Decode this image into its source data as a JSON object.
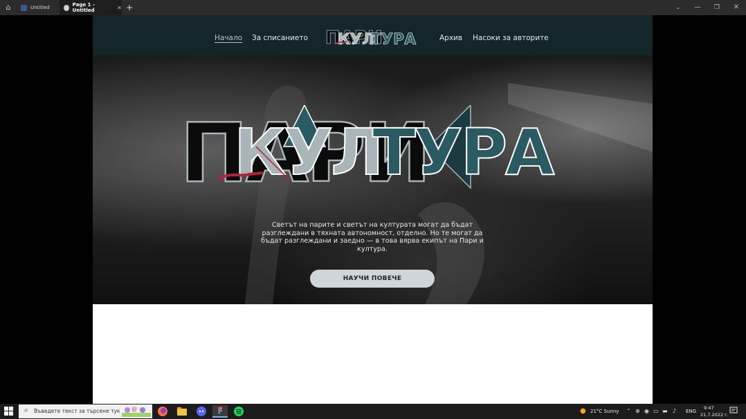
{
  "titlebar": {
    "tabs": [
      {
        "label": "Untitled"
      },
      {
        "label": "Page 1 - Untitled"
      }
    ]
  },
  "site": {
    "nav": {
      "home": "Начало",
      "about": "За списанието",
      "archive": "Архив",
      "authors": "Насоки за авторите"
    },
    "logo_text": "Пари и Култура",
    "hero": {
      "description": "Светът на парите и светът на културата могат да бъдат разглеждани в тяхната автономност, отделно. Но те могат да бъдат разглеждани и заедно — в това вярва екипът на Пари и култура.",
      "cta_label": "НАУЧИ ПОВЕЧЕ"
    },
    "colors": {
      "nav_bg": "#14262a",
      "accent_teal": "#2a5a62",
      "accent_gray": "#a9b5b8",
      "accent_red": "#b3213a",
      "cta_bg": "#cfd5d8"
    }
  },
  "taskbar": {
    "search_placeholder": "Въведете текст за търсене тук",
    "weather": "21°C  Sunny",
    "language": "ENG",
    "time": "9:47",
    "date": "21.7.2022 г."
  }
}
